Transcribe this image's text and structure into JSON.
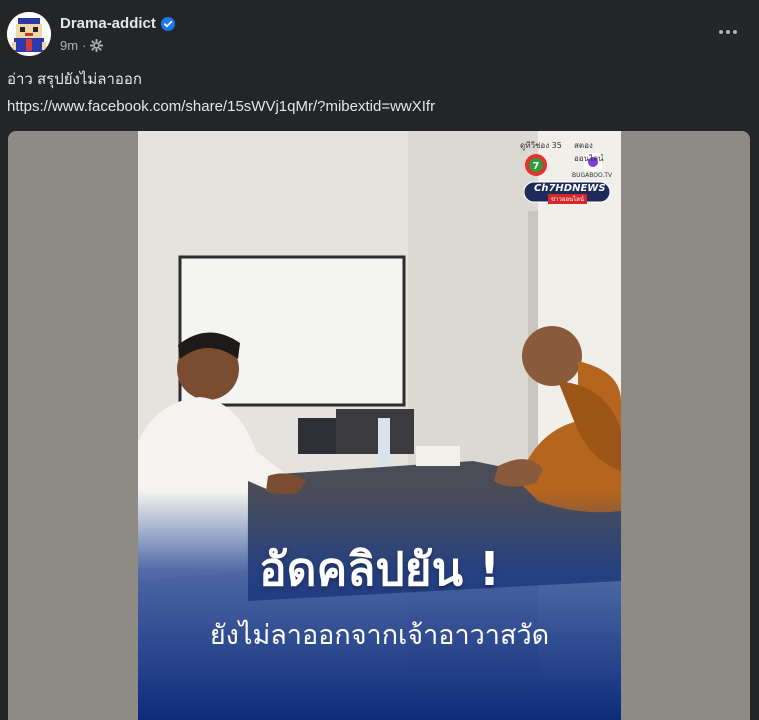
{
  "post": {
    "author": "Drama-addict",
    "time": "9m",
    "separator": "·",
    "caption": "อ่าว สรุปยังไม่ลาออก",
    "link": "https://www.facebook.com/share/15sWVj1qMr/?mibextid=wwXIfr"
  },
  "video": {
    "overlay_title": "อัดคลิปยัน !",
    "overlay_subtitle": "ยังไม่ลาออกจากเจ้าอาวาสวัด",
    "channel_top_left": "ดูทีวีช่อง 35",
    "channel_top_right": "สตองออนไลน์",
    "bugaboo_label": "BUGABOO.TV",
    "news_badge": "Ch7HDNEWS",
    "news_badge_sub": "ข่าวออนไลน์"
  },
  "icons": {
    "verified": "verified-badge-icon",
    "audience": "gear-icon",
    "more": "more-options-icon"
  },
  "colors": {
    "background": "#242526",
    "text": "#e4e6eb",
    "secondary_text": "#b0b3b8",
    "verified_blue": "#1877f2",
    "news_blue": "#1a3d8f"
  }
}
